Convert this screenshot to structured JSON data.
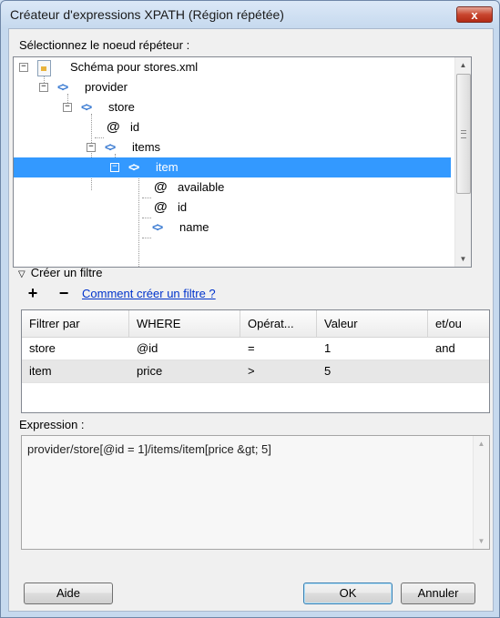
{
  "window": {
    "title": "Créateur d'expressions XPATH (Région répétée)",
    "close_label": "x"
  },
  "tree_section": {
    "label": "Sélectionnez le noeud répéteur :",
    "nodes": [
      {
        "label": "Schéma pour stores.xml",
        "icon": "schema-file-icon",
        "toggle": "−"
      },
      {
        "label": "provider",
        "icon": "element-icon",
        "toggle": "−"
      },
      {
        "label": "store",
        "icon": "element-icon",
        "toggle": "−"
      },
      {
        "label": "id",
        "icon": "attribute-icon",
        "toggle": ""
      },
      {
        "label": "items",
        "icon": "element-icon",
        "toggle": "−"
      },
      {
        "label": "item",
        "icon": "element-icon",
        "toggle": "−",
        "selected": true
      },
      {
        "label": "available",
        "icon": "attribute-icon",
        "toggle": ""
      },
      {
        "label": "id",
        "icon": "attribute-icon",
        "toggle": ""
      },
      {
        "label": "name",
        "icon": "element-icon",
        "toggle": ""
      }
    ]
  },
  "filter": {
    "toggle_label": "Créer un filtre",
    "add_label": "+",
    "remove_label": "−",
    "help_link": "Comment créer un filtre ?",
    "columns": [
      "Filtrer par",
      "WHERE",
      "Opérat...",
      "Valeur",
      "et/ou"
    ],
    "rows": [
      [
        "store",
        "@id",
        "=",
        "1",
        "and"
      ],
      [
        "item",
        "price",
        ">",
        "5",
        ""
      ]
    ]
  },
  "expression": {
    "label": "Expression :",
    "value": "provider/store[@id = 1]/items/item[price &gt; 5]"
  },
  "buttons": {
    "help": "Aide",
    "ok": "OK",
    "cancel": "Annuler"
  },
  "colors": {
    "selection": "#3399ff",
    "element_icon": "#3f7ed3",
    "link": "#0033cc",
    "close_button": "#c8462f"
  }
}
